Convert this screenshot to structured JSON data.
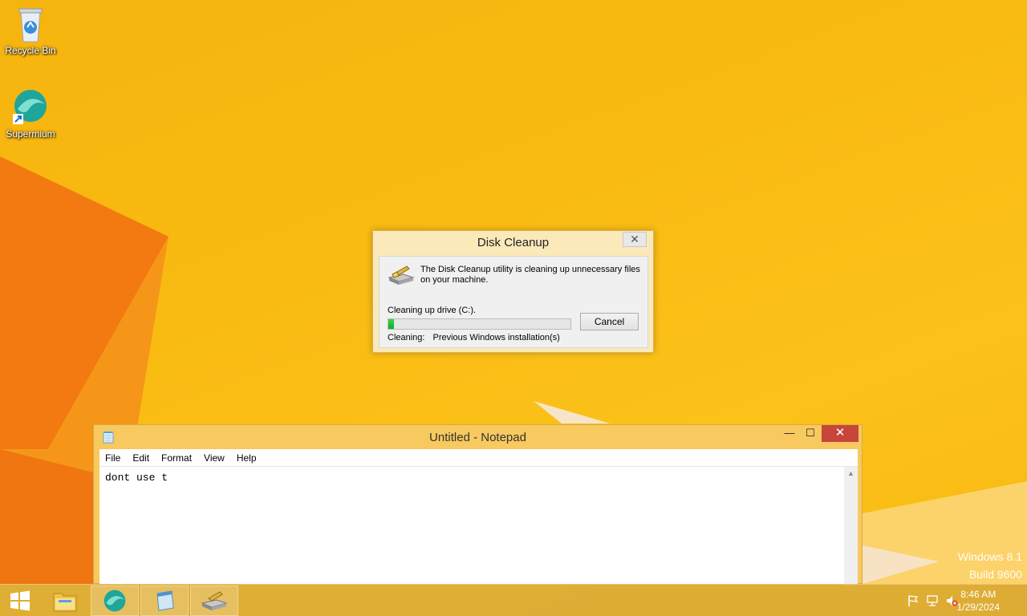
{
  "desktop": {
    "icons": [
      {
        "label": "Recycle Bin",
        "icon": "recycle-bin-icon"
      },
      {
        "label": "Supermium",
        "icon": "supermium-icon"
      }
    ],
    "watermark": {
      "line1": "Windows 8.1",
      "line2": "Build 9600"
    }
  },
  "disk_cleanup": {
    "title": "Disk Cleanup",
    "close_glyph": "✕",
    "message": "The Disk Cleanup utility is cleaning up unnecessary files on your machine.",
    "drive_label": "Cleaning up drive  (C:).",
    "progress_percent": 3,
    "cancel_label": "Cancel",
    "cleaning_label": "Cleaning:",
    "cleaning_item": "Previous Windows installation(s)"
  },
  "notepad": {
    "title": "Untitled - Notepad",
    "minimize_glyph": "—",
    "maximize_glyph": "☐",
    "close_glyph": "✕",
    "menu": [
      "File",
      "Edit",
      "Format",
      "View",
      "Help"
    ],
    "content": "dont use t"
  },
  "taskbar": {
    "items": [
      {
        "name": "file-explorer",
        "icon": "folder-icon"
      },
      {
        "name": "supermium",
        "icon": "supermium-icon"
      },
      {
        "name": "notepad",
        "icon": "notepad-icon"
      },
      {
        "name": "disk-cleanup",
        "icon": "disk-cleanup-icon"
      }
    ],
    "time": "8:46 AM",
    "date": "1/29/2024"
  },
  "colors": {
    "desktop_bg": "#f9bb12",
    "notepad_frame": "#f7c95e",
    "dialog_frame": "#fbe9b9",
    "close_red": "#c7453b",
    "progress_green": "#06b025"
  }
}
